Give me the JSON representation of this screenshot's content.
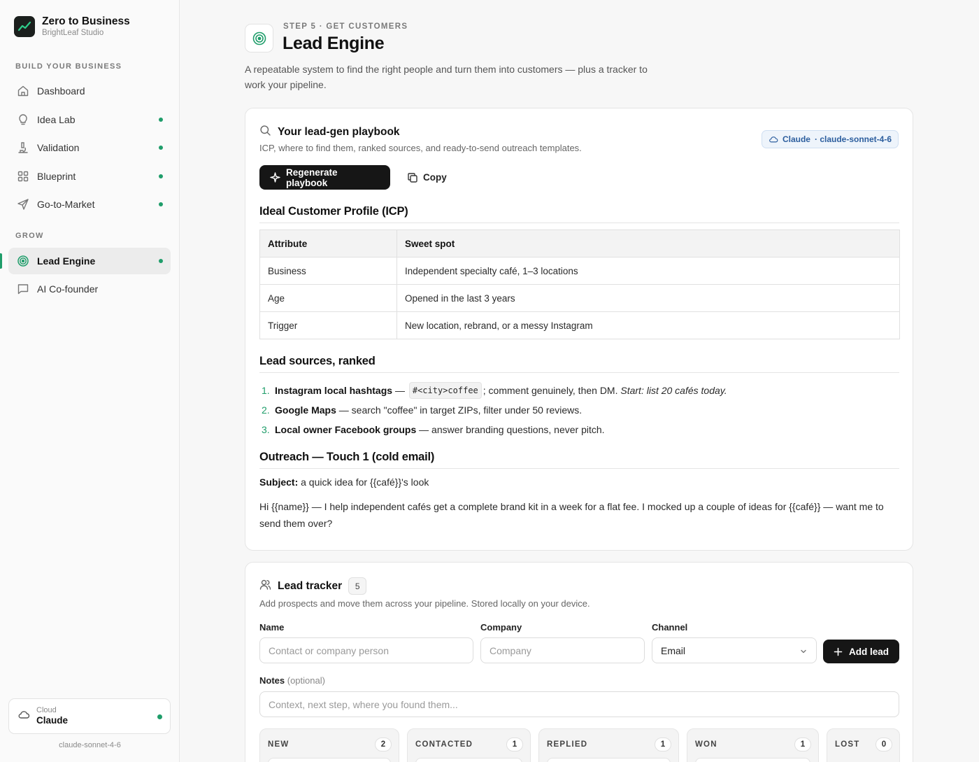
{
  "app": {
    "title": "Zero to Business",
    "subtitle": "BrightLeaf Studio"
  },
  "sidebar": {
    "section_build": "BUILD YOUR BUSINESS",
    "section_grow": "GROW",
    "items": [
      {
        "label": "Dashboard",
        "icon": "home-icon",
        "status_dot": false
      },
      {
        "label": "Idea Lab",
        "icon": "lightbulb-icon",
        "status_dot": true
      },
      {
        "label": "Validation",
        "icon": "microscope-icon",
        "status_dot": true
      },
      {
        "label": "Blueprint",
        "icon": "grid-icon",
        "status_dot": true
      },
      {
        "label": "Go-to-Market",
        "icon": "send-icon",
        "status_dot": true
      },
      {
        "label": "Lead Engine",
        "icon": "target-icon",
        "status_dot": true,
        "active": true
      },
      {
        "label": "AI Co-founder",
        "icon": "chat-icon",
        "status_dot": false
      }
    ],
    "cloud": {
      "small": "Cloud",
      "name": "Claude",
      "model": "claude-sonnet-4-6"
    }
  },
  "header": {
    "eyebrow": "STEP 5 · GET CUSTOMERS",
    "title": "Lead Engine",
    "description": "A repeatable system to find the right people and turn them into customers — plus a tracker to work your pipeline."
  },
  "playbook": {
    "title": "Your lead-gen playbook",
    "subtitle": "ICP, where to find them, ranked sources, and ready-to-send outreach templates.",
    "provider_pill": {
      "name": "Claude",
      "model": "· claude-sonnet-4-6"
    },
    "regenerate_label": "Regenerate playbook",
    "copy_label": "Copy",
    "icp_heading": "Ideal Customer Profile (ICP)",
    "icp_table": {
      "headers": [
        "Attribute",
        "Sweet spot"
      ],
      "rows": [
        [
          "Business",
          "Independent specialty café, 1–3 locations"
        ],
        [
          "Age",
          "Opened in the last 3 years"
        ],
        [
          "Trigger",
          "New location, rebrand, or a messy Instagram"
        ]
      ]
    },
    "sources_heading": "Lead sources, ranked",
    "sources": [
      {
        "num": "1.",
        "name": "Instagram local hashtags",
        "pre": " — ",
        "code": "#<city>coffee",
        "text": "; comment genuinely, then DM. ",
        "italic": "Start: list 20 cafés today."
      },
      {
        "num": "2.",
        "name": "Google Maps",
        "text": " — search \"coffee\" in target ZIPs, filter under 50 reviews."
      },
      {
        "num": "3.",
        "name": "Local owner Facebook groups",
        "text": " — answer branding questions, never pitch."
      }
    ],
    "outreach_heading": "Outreach — Touch 1 (cold email)",
    "subject_label": "Subject:",
    "subject_text": " a quick idea for {{café}}'s look",
    "body": "Hi {{name}} — I help independent cafés get a complete brand kit in a week for a flat fee. I mocked up a couple of ideas for {{café}} — want me to send them over?"
  },
  "tracker": {
    "title": "Lead tracker",
    "count": "5",
    "subtitle": "Add prospects and move them across your pipeline. Stored locally on your device.",
    "name_label": "Name",
    "name_placeholder": "Contact or company person",
    "company_label": "Company",
    "company_placeholder": "Company",
    "channel_label": "Channel",
    "channel_value": "Email",
    "add_label": "Add lead",
    "notes_label": "Notes",
    "notes_optional": "(optional)",
    "notes_placeholder": "Context, next step, where you found them...",
    "columns": [
      {
        "name": "NEW",
        "count": "2"
      },
      {
        "name": "CONTACTED",
        "count": "1"
      },
      {
        "name": "REPLIED",
        "count": "1"
      },
      {
        "name": "WON",
        "count": "1"
      },
      {
        "name": "LOST",
        "count": "0"
      }
    ]
  },
  "colors": {
    "accent": "#1f9d6a",
    "dark": "#161616",
    "pill_text": "#2c5e9e"
  }
}
